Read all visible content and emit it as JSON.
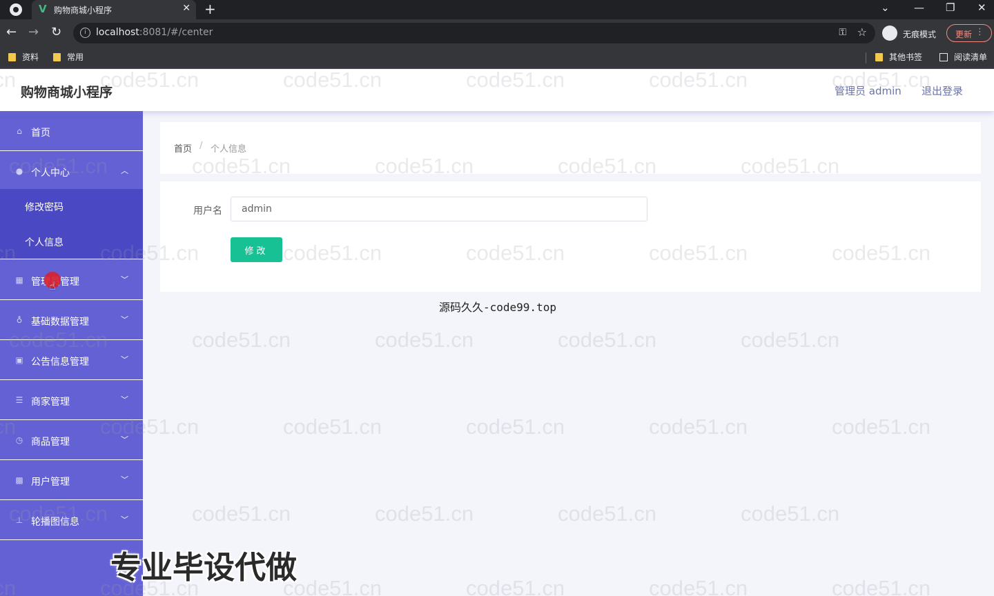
{
  "browser": {
    "tab_title": "购物商城小程序",
    "tab_close": "✕",
    "new_tab": "+",
    "url_host": "localhost",
    "url_rest": ":8081/#/center",
    "incognito_label": "无痕模式",
    "update_label": "更新",
    "bookmarks": [
      "资料",
      "常用"
    ],
    "bookmarks_right": [
      "其他书签",
      "阅读清单"
    ]
  },
  "app": {
    "title": "购物商城小程序",
    "user": "管理员 admin",
    "logout": "退出登录"
  },
  "sidebar": {
    "items": [
      {
        "label": "首页",
        "icon": "home-icon"
      },
      {
        "label": "个人中心",
        "icon": "user-icon",
        "expanded": true
      },
      {
        "label": "管理员管理",
        "icon": "admin-icon"
      },
      {
        "label": "基础数据管理",
        "icon": "data-icon"
      },
      {
        "label": "公告信息管理",
        "icon": "notice-icon"
      },
      {
        "label": "商家管理",
        "icon": "merchant-icon"
      },
      {
        "label": "商品管理",
        "icon": "goods-icon"
      },
      {
        "label": "用户管理",
        "icon": "users-icon"
      },
      {
        "label": "轮播图信息",
        "icon": "carousel-icon"
      }
    ],
    "subitems": [
      {
        "label": "修改密码"
      },
      {
        "label": "个人信息"
      }
    ]
  },
  "breadcrumb": {
    "home": "首页",
    "separator": "/",
    "current": "个人信息"
  },
  "form": {
    "username_label": "用户名",
    "username_value": "admin",
    "submit_label": "修改"
  },
  "watermarks": {
    "tiled": "code51.cn",
    "code99": "源码久久-code99.top",
    "promo": "专业毕设代做"
  },
  "colors": {
    "sidebar": "#6361d3",
    "sidebar_sub": "#4a48c2",
    "primary_button": "#17c194",
    "header_link": "#6a72a8"
  }
}
